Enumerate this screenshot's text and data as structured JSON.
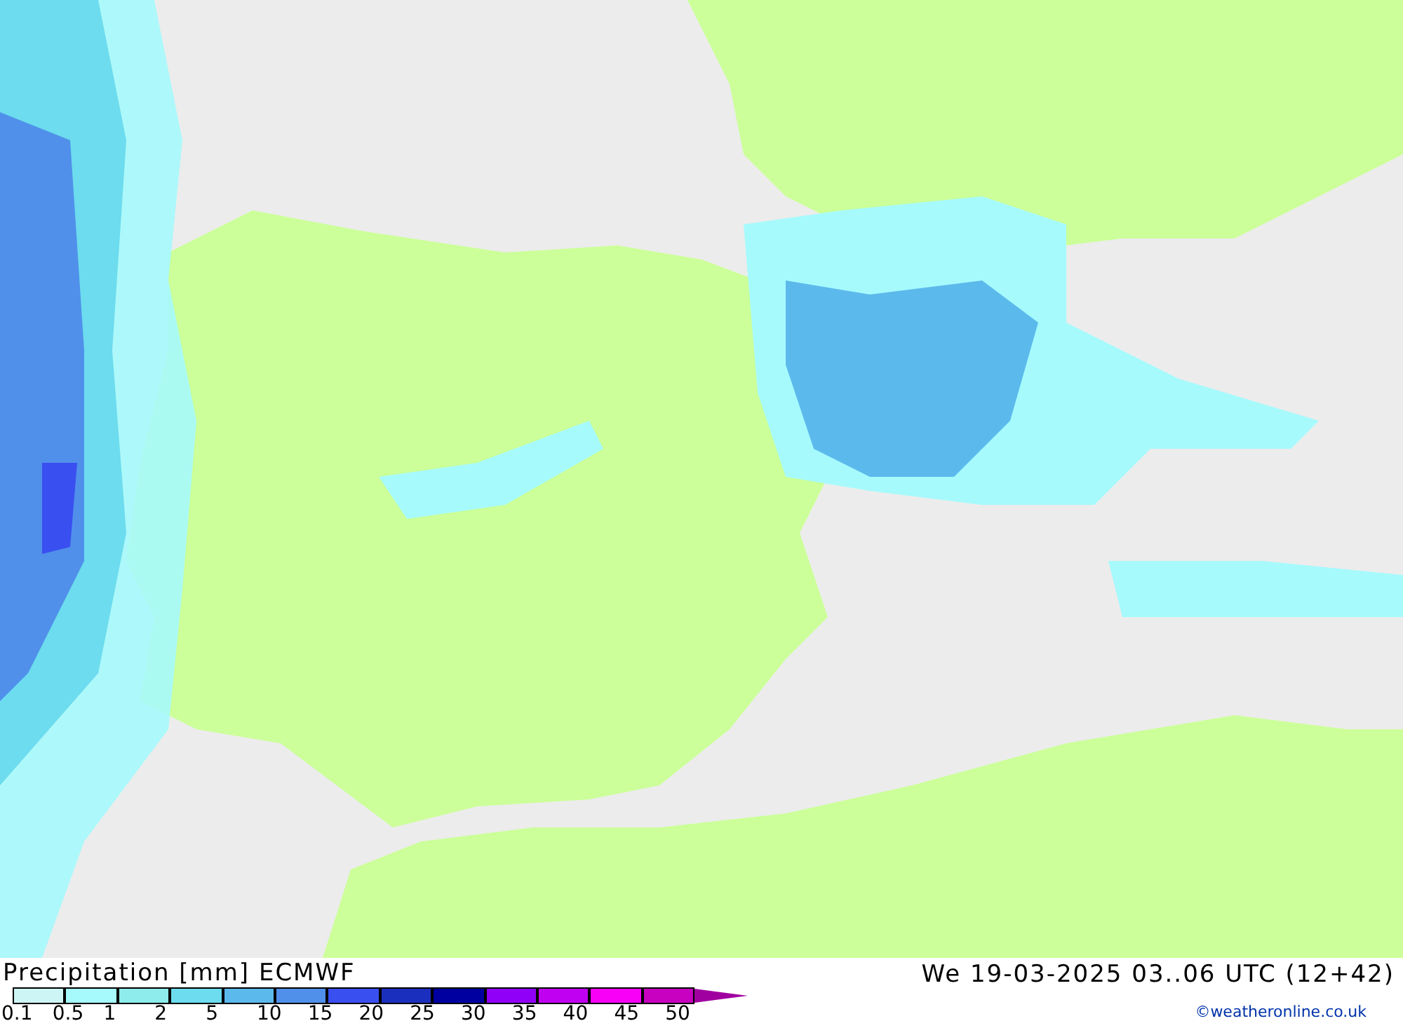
{
  "title": "Precipitation [mm] ECMWF",
  "valid_time": "We 19-03-2025 03..06 UTC (12+42)",
  "legend": {
    "segments": [
      {
        "color": "#cdf5f5"
      },
      {
        "color": "#a6fafc"
      },
      {
        "color": "#8eecec"
      },
      {
        "color": "#6cdcee"
      },
      {
        "color": "#5cb9ec"
      },
      {
        "color": "#5090ea"
      },
      {
        "color": "#3a4ff0"
      },
      {
        "color": "#1b2fbf"
      },
      {
        "color": "#0000a0"
      },
      {
        "color": "#9000f8"
      },
      {
        "color": "#c000f0"
      },
      {
        "color": "#f800f8"
      },
      {
        "color": "#c800c0"
      }
    ],
    "labels": [
      "0.1",
      "0.5",
      "1",
      "2",
      "5",
      "10",
      "15",
      "20",
      "25",
      "30",
      "35",
      "40",
      "45",
      "50"
    ]
  },
  "credit": "©weatheronline.co.uk"
}
